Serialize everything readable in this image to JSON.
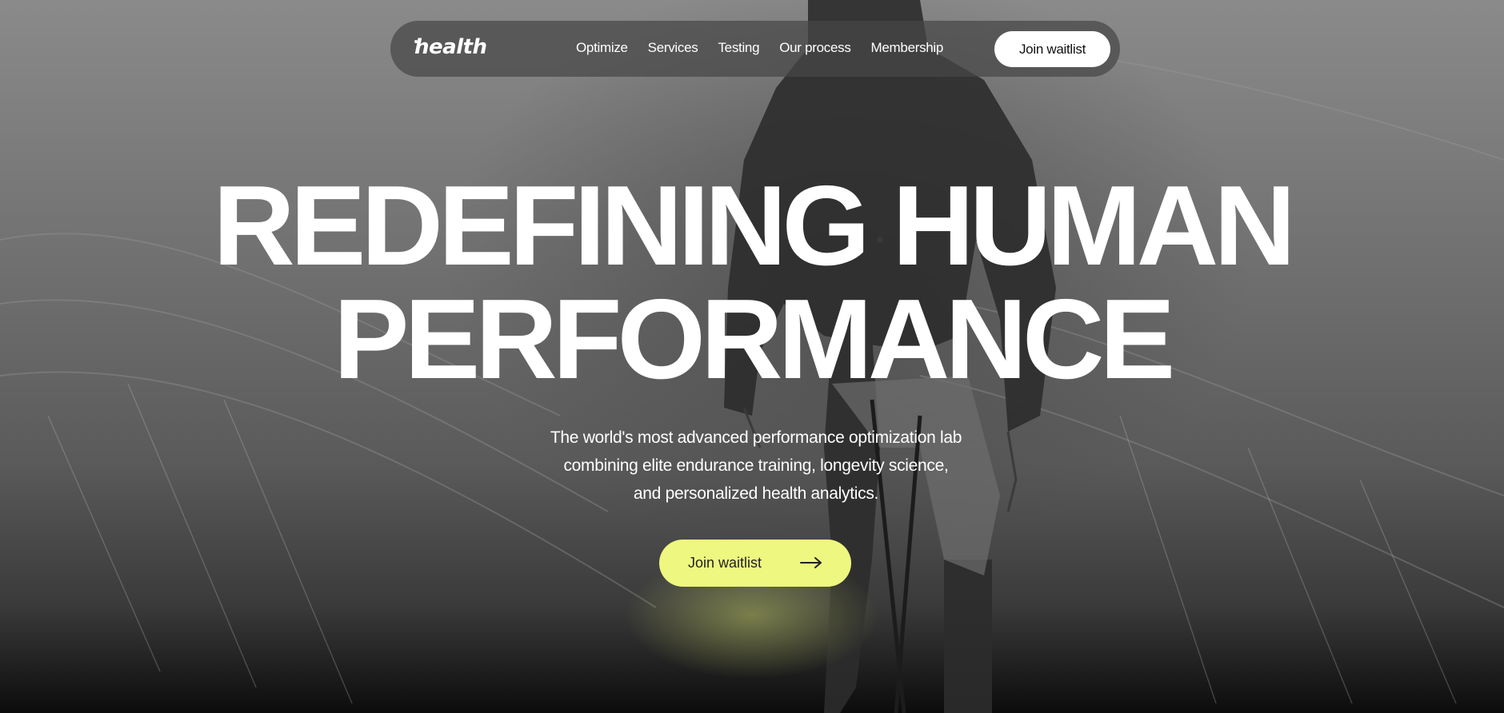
{
  "brand": {
    "logo_text": "health"
  },
  "nav": {
    "links": [
      "Optimize",
      "Services",
      "Testing",
      "Our process",
      "Membership"
    ],
    "cta_label": "Join waitlist"
  },
  "hero": {
    "headline_line1": "REDEFINING HUMAN",
    "headline_line2": "PERFORMANCE",
    "subtitle_line1": "The world's most advanced performance optimization lab",
    "subtitle_line2": "combining elite endurance training, longevity science,",
    "subtitle_line3": "and personalized health analytics.",
    "cta_label": "Join waitlist",
    "cta_icon": "arrow-right-icon",
    "background_image": "cyclist-in-grass-photo"
  },
  "colors": {
    "accent": "#eef77f",
    "text": "#ffffff",
    "nav_bg": "#464646"
  }
}
